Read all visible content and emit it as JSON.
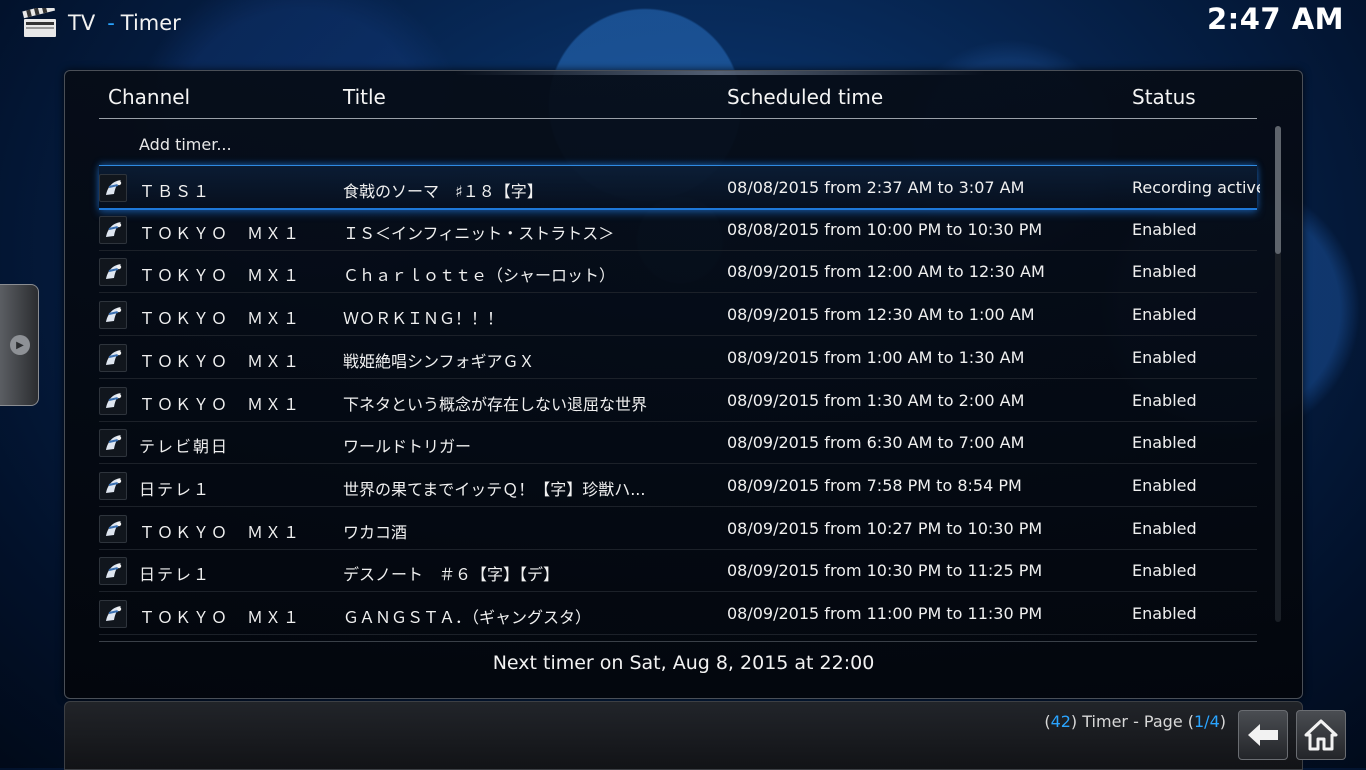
{
  "header": {
    "section": "TV",
    "separator": "-",
    "page": "Timer",
    "clock": "2:47 AM"
  },
  "columns": {
    "channel": "Channel",
    "title": "Title",
    "scheduled": "Scheduled time",
    "status": "Status"
  },
  "add_timer_label": "Add timer...",
  "timers": [
    {
      "channel": "ＴＢＳ１",
      "title": "食戟のソーマ　♯１８【字】",
      "time": "08/08/2015 from 2:37 AM to 3:07 AM",
      "status": "Recording active"
    },
    {
      "channel": "ＴＯＫＹＯ　ＭＸ１",
      "title": "ＩＳ＜インフィニット・ストラトス＞",
      "time": "08/08/2015 from 10:00 PM to 10:30 PM",
      "status": "Enabled"
    },
    {
      "channel": "ＴＯＫＹＯ　ＭＸ１",
      "title": "Ｃｈａｒｌｏｔｔｅ（シャーロット）",
      "time": "08/09/2015 from 12:00 AM to 12:30 AM",
      "status": "Enabled"
    },
    {
      "channel": "ＴＯＫＹＯ　ＭＸ１",
      "title": "ＷＯＲＫＩＮＧ！！！",
      "time": "08/09/2015 from 12:30 AM to 1:00 AM",
      "status": "Enabled"
    },
    {
      "channel": "ＴＯＫＹＯ　ＭＸ１",
      "title": "戦姫絶唱シンフォギアＧＸ",
      "time": "08/09/2015 from 1:00 AM to 1:30 AM",
      "status": "Enabled"
    },
    {
      "channel": "ＴＯＫＹＯ　ＭＸ１",
      "title": "下ネタという概念が存在しない退屈な世界",
      "time": "08/09/2015 from 1:30 AM to 2:00 AM",
      "status": "Enabled"
    },
    {
      "channel": "テレビ朝日",
      "title": "ワールドトリガー",
      "time": "08/09/2015 from 6:30 AM to 7:00 AM",
      "status": "Enabled"
    },
    {
      "channel": "日テレ１",
      "title": "世界の果てまでイッテＱ！【字】珍獣ハ...",
      "time": "08/09/2015 from 7:58 PM to 8:54 PM",
      "status": "Enabled"
    },
    {
      "channel": "ＴＯＫＹＯ　ＭＸ１",
      "title": "ワカコ酒",
      "time": "08/09/2015 from 10:27 PM to 10:30 PM",
      "status": "Enabled"
    },
    {
      "channel": "日テレ１",
      "title": "デスノート　＃６【字】【デ】",
      "time": "08/09/2015 from 10:30 PM to 11:25 PM",
      "status": "Enabled"
    },
    {
      "channel": "ＴＯＫＹＯ　ＭＸ１",
      "title": "ＧＡＮＧＳＴＡ．（ギャングスタ）",
      "time": "08/09/2015 from 11:00 PM to 11:30 PM",
      "status": "Enabled"
    }
  ],
  "next_timer": "Next timer on Sat, Aug 8, 2015 at 22:00",
  "footer": {
    "count": "42",
    "label": "Timer - Page",
    "page": "1/4"
  },
  "accent_color": "#2aa4ff",
  "icons": {
    "app": "clapperboard-icon",
    "channel": "channel-logo-icon",
    "back": "back-arrow-icon",
    "home": "home-icon",
    "side": "chevron-right-icon"
  }
}
